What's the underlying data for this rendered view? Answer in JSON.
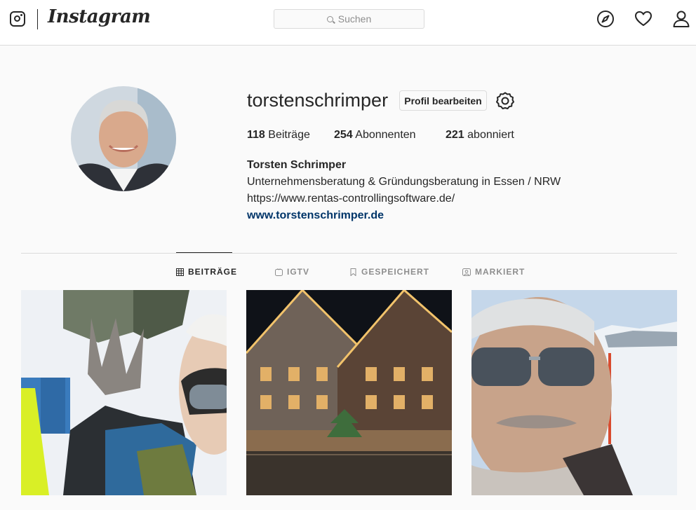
{
  "nav": {
    "brand": "Instagram",
    "search_placeholder": "Suchen",
    "icons": [
      "instagram-glyph-icon",
      "compass-icon",
      "heart-icon",
      "profile-icon"
    ]
  },
  "profile": {
    "username": "torstenschrimper",
    "edit_label": "Profil bearbeiten",
    "stats": {
      "posts_count": "118",
      "posts_label": "Beiträge",
      "followers_count": "254",
      "followers_label": "Abonnenten",
      "following_count": "221",
      "following_label": "abonniert"
    },
    "full_name": "Torsten Schrimper",
    "bio_line1": "Unternehmensberatung & Gründungsberatung in Essen / NRW",
    "bio_line2": "https://www.rentas-controllingsoftware.de/",
    "website": "www.torstenschrimper.de"
  },
  "tabs": [
    {
      "label": "BEITRÄGE",
      "active": true
    },
    {
      "label": "IGTV",
      "active": false
    },
    {
      "label": "GESPEICHERT",
      "active": false
    },
    {
      "label": "MARKIERT",
      "active": false
    }
  ],
  "colors": {
    "link": "#003569",
    "border": "#dbdbdb",
    "text": "#262626",
    "muted": "#8e8e8e"
  }
}
